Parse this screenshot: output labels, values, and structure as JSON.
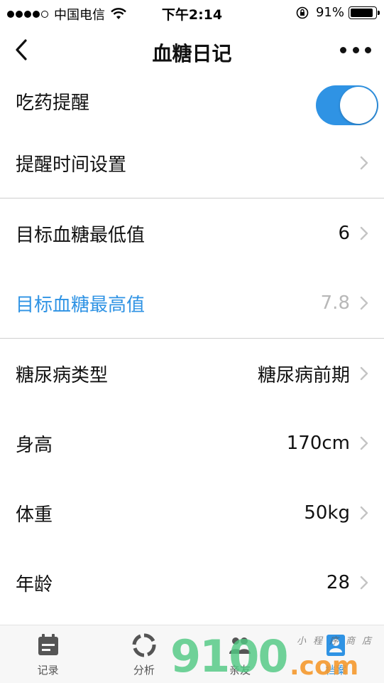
{
  "status_bar": {
    "carrier": "中国电信",
    "time": "下午2:14",
    "battery_pct": "91%",
    "battery_level": 0.91
  },
  "nav": {
    "title": "血糖日记"
  },
  "settings": {
    "medication_reminder": {
      "label": "吃药提醒",
      "enabled": true
    },
    "reminder_time": {
      "label": "提醒时间设置"
    },
    "target_min": {
      "label": "目标血糖最低值",
      "value": "6"
    },
    "target_max": {
      "label": "目标血糖最高值",
      "value": "7.8"
    },
    "diabetes_type": {
      "label": "糖尿病类型",
      "value": "糖尿病前期"
    },
    "height": {
      "label": "身高",
      "value": "170cm"
    },
    "weight": {
      "label": "体重",
      "value": "50kg"
    },
    "age": {
      "label": "年龄",
      "value": "28"
    }
  },
  "tabs": [
    {
      "label": "记录",
      "icon": "calendar-icon"
    },
    {
      "label": "分析",
      "icon": "ring-chart-icon"
    },
    {
      "label": "亲友",
      "icon": "people-icon"
    },
    {
      "label": "档案",
      "icon": "profile-card-icon",
      "active": true
    }
  ],
  "watermark": {
    "main": "9100",
    "suffix": ".com",
    "small": "小程序商店"
  },
  "colors": {
    "accent": "#2f93e4",
    "muted": "#b8b8b8",
    "divider": "#cfcfcf"
  }
}
